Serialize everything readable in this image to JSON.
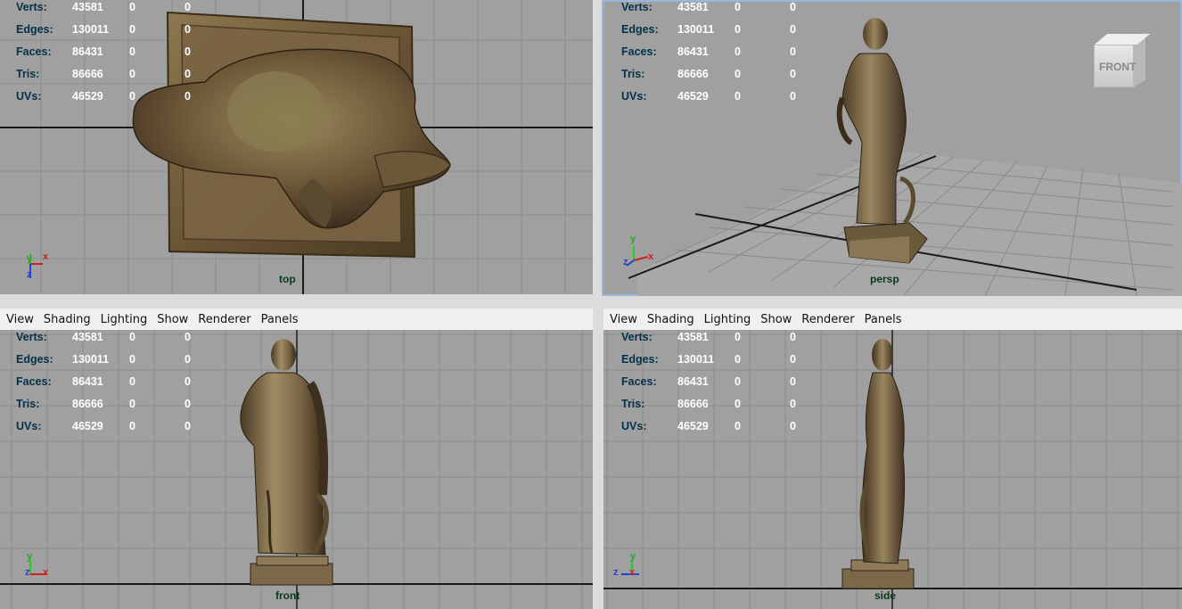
{
  "stats": {
    "labels": [
      "Verts:",
      "Edges:",
      "Faces:",
      "Tris:",
      "UVs:"
    ],
    "rows": [
      {
        "label": "Verts:",
        "v1": "43581",
        "v2": "0",
        "v3": "0"
      },
      {
        "label": "Edges:",
        "v1": "130011",
        "v2": "0",
        "v3": "0"
      },
      {
        "label": "Faces:",
        "v1": "86431",
        "v2": "0",
        "v3": "0"
      },
      {
        "label": "Tris:",
        "v1": "86666",
        "v2": "0",
        "v3": "0"
      },
      {
        "label": "UVs:",
        "v1": "46529",
        "v2": "0",
        "v3": "0"
      }
    ]
  },
  "menu": {
    "view": "View",
    "shading": "Shading",
    "lighting": "Lighting",
    "show": "Show",
    "renderer": "Renderer",
    "panels": "Panels"
  },
  "viewports": {
    "top": {
      "camera": "top"
    },
    "persp": {
      "camera": "persp",
      "viewcube": "FRONT"
    },
    "front": {
      "camera": "front"
    },
    "side": {
      "camera": "side"
    }
  },
  "axes": {
    "x": "x",
    "y": "y",
    "z": "z"
  },
  "colors": {
    "viewport_bg": "#a0a0a0",
    "grid_line": "#8a8a8a",
    "grid_axis": "#1a1a1a",
    "bronze": "#7a6646",
    "active_border": "#9ab6d8"
  }
}
